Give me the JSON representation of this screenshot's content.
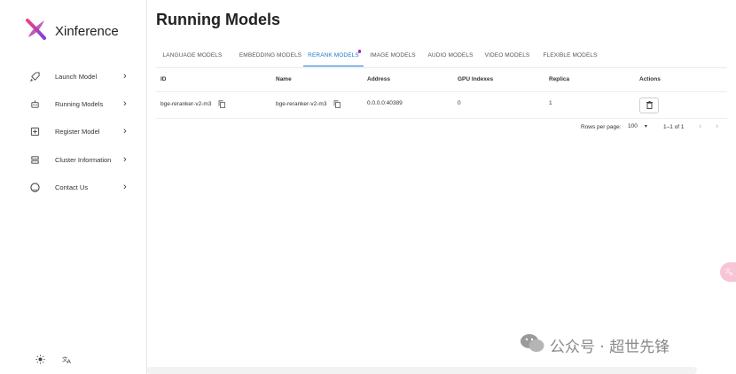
{
  "app": {
    "title": "Xinference"
  },
  "sidebar": {
    "items": [
      {
        "label": "Launch Model",
        "icon": "rocket-icon"
      },
      {
        "label": "Running Models",
        "icon": "robot-icon"
      },
      {
        "label": "Register Model",
        "icon": "add-box-icon"
      },
      {
        "label": "Cluster Information",
        "icon": "storage-icon"
      },
      {
        "label": "Contact Us",
        "icon": "github-icon"
      }
    ],
    "bottom": {
      "theme_icon": "sun-icon",
      "language_icon": "translate-icon"
    }
  },
  "page": {
    "title": "Running Models"
  },
  "tabs": [
    {
      "label": "LANGUAGE MODELS"
    },
    {
      "label": "EMBEDDING MODELS"
    },
    {
      "label": "RERANK MODELS",
      "active": true
    },
    {
      "label": "IMAGE MODELS"
    },
    {
      "label": "AUDIO MODELS"
    },
    {
      "label": "VIDEO MODELS"
    },
    {
      "label": "FLEXIBLE MODELS"
    }
  ],
  "table": {
    "headers": [
      "ID",
      "Name",
      "Address",
      "GPU Indexes",
      "Replica",
      "Actions"
    ],
    "rows": [
      {
        "id": "bge-reranker-v2-m3",
        "name": "bge-reranker-v2-m3",
        "address": "0.0.0.0:40389",
        "gpu_indexes": "0",
        "replica": "1"
      }
    ]
  },
  "pagination": {
    "rows_per_page_label": "Rows per page:",
    "rows_per_page_value": "100",
    "range": "1–1 of 1"
  },
  "watermark": {
    "text": "公众号 · 超世先锋"
  },
  "colors": {
    "accent": "#1976d2",
    "dot": "#9c27b0",
    "float_button": "#f7c6d6"
  }
}
